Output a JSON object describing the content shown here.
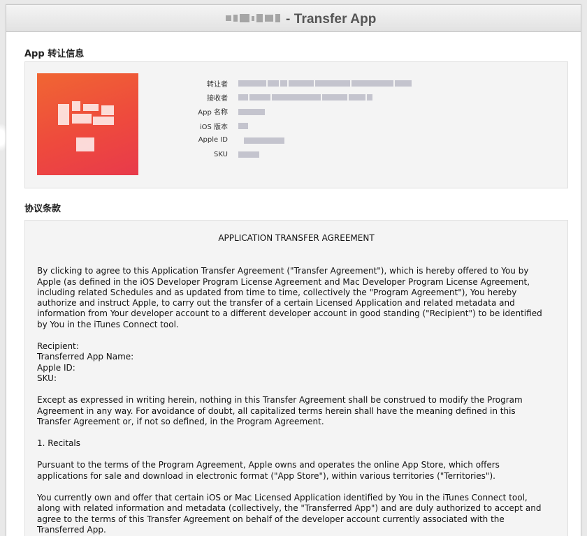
{
  "window": {
    "title": "- Transfer App"
  },
  "app_info": {
    "heading": "App 转让信息",
    "fields": [
      {
        "label": "转让者"
      },
      {
        "label": "接收者"
      },
      {
        "label": "App 名称"
      },
      {
        "label": "iOS 版本"
      },
      {
        "label": "Apple ID"
      },
      {
        "label": "SKU"
      }
    ]
  },
  "terms": {
    "heading": "协议条款",
    "agreement_title": "APPLICATION TRANSFER AGREEMENT",
    "para1": "By clicking to agree to this Application Transfer Agreement (\"Transfer Agreement\"), which is hereby offered to You by\nApple (as defined in the iOS Developer Program License Agreement and Mac Developer Program License Agreement,\nincluding related Schedules and as updated from time to time, collectively the \"Program Agreement\"), You hereby\nauthorize and instruct Apple, to carry out the transfer of a certain Licensed Application and related metadata and\ninformation from Your developer account to a different developer account in good standing (\"Recipient\") to be identified\nby You in the iTunes Connect tool.",
    "recipient_label": "Recipient:",
    "transferred_name_label": "Transferred App Name:",
    "apple_id_label": "Apple ID:",
    "sku_label": "SKU:",
    "para2": "Except as expressed in writing herein, nothing in this Transfer Agreement shall be construed to modify the Program\nAgreement in any way. For avoidance of doubt, all capitalized terms herein shall have the meaning defined in this\nTransfer Agreement or, if not so defined, in the Program Agreement.",
    "section1": "1.  Recitals",
    "para3": "Pursuant to the terms of the Program Agreement, Apple owns and operates the online App Store, which offers\napplications for sale and download in electronic format (\"App Store\"), within various territories (\"Territories\").",
    "para4": "You currently own and offer that certain iOS or Mac Licensed Application identified by You in the iTunes Connect tool,\nalong with related information and metadata (collectively, the \"Transferred App\") and are duly authorized to accept and\nagree to the terms of this Transfer Agreement on behalf of the developer account currently associated with the\nTransferred App."
  }
}
